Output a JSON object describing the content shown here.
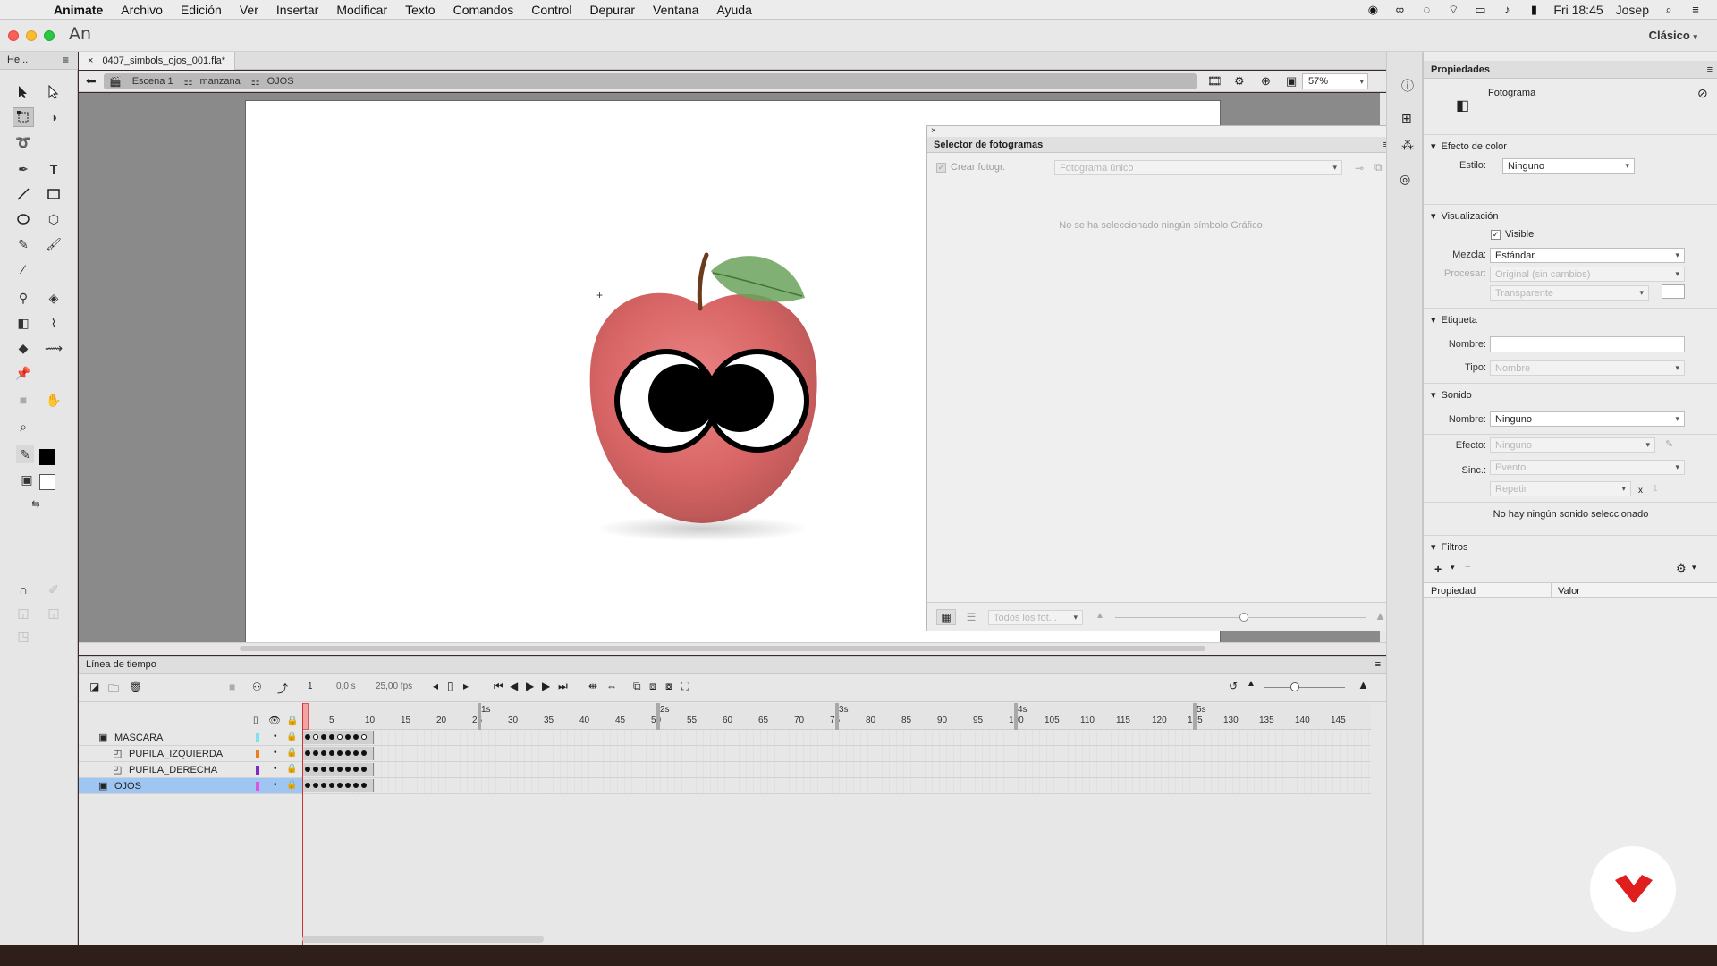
{
  "menubar": {
    "app": "Animate",
    "items": [
      "Archivo",
      "Edición",
      "Ver",
      "Insertar",
      "Modificar",
      "Texto",
      "Comandos",
      "Control",
      "Depurar",
      "Ventana",
      "Ayuda"
    ],
    "clock": "Fri 18:45",
    "user": "Josep"
  },
  "window": {
    "app_short": "An",
    "workspace": "Clásico"
  },
  "tools_panel": {
    "title": "He..."
  },
  "document": {
    "tab": "0407_simbols_ojos_001.fla*",
    "breadcrumbs": [
      "Escena 1",
      "manzana",
      "OJOS"
    ],
    "zoom": "57%"
  },
  "frame_picker": {
    "title": "Selector de fotogramas",
    "create_frame_label": "Crear fotogr.",
    "mode_value": "Fotograma único",
    "message": "No se ha seleccionado ningún símbolo Gráfico",
    "filter_value": "Todos los fot..."
  },
  "timeline": {
    "title": "Línea de tiempo",
    "current_frame": "1",
    "time": "0,0 s",
    "fps": "25,00 fps",
    "ruler_ticks": [
      "5",
      "10",
      "15",
      "20",
      "25",
      "30",
      "35",
      "40",
      "45",
      "50",
      "55",
      "60",
      "65",
      "70",
      "75",
      "80",
      "85",
      "90",
      "95",
      "100",
      "105",
      "110",
      "115",
      "120",
      "125",
      "130",
      "135",
      "140",
      "145"
    ],
    "second_markers": [
      "1s",
      "2s",
      "3s",
      "4s",
      "5s"
    ],
    "layers": [
      {
        "name": "MASCARA",
        "color": "#7fe3e6",
        "selected": false,
        "indent": 0
      },
      {
        "name": "PUPILA_IZQUIERDA",
        "color": "#f07b1e",
        "selected": false,
        "indent": 1
      },
      {
        "name": "PUPILA_DERECHA",
        "color": "#7a2dbf",
        "selected": false,
        "indent": 1
      },
      {
        "name": "OJOS",
        "color": "#e052e0",
        "selected": true,
        "indent": 0
      }
    ]
  },
  "properties": {
    "title": "Propiedades",
    "object_type": "Fotograma",
    "color_effect": {
      "header": "Efecto de color",
      "style_label": "Estilo:",
      "style_value": "Ninguno"
    },
    "display": {
      "header": "Visualización",
      "visible_label": "Visible",
      "visible_checked": true,
      "blend_label": "Mezcla:",
      "blend_value": "Estándar",
      "render_label": "Procesar:",
      "render_value": "Original (sin cambios)",
      "transparent_value": "Transparente"
    },
    "label": {
      "header": "Etiqueta",
      "name_label": "Nombre:",
      "name_value": "",
      "type_label": "Tipo:",
      "type_value": "Nombre"
    },
    "sound": {
      "header": "Sonido",
      "name_label": "Nombre:",
      "name_value": "Ninguno",
      "effect_label": "Efecto:",
      "effect_value": "Ninguno",
      "sync_label": "Sinc.:",
      "sync_value": "Evento",
      "repeat_value": "Repetir",
      "repeat_x": "x",
      "repeat_count": "1",
      "none_msg": "No hay ningún sonido seleccionado"
    },
    "filters": {
      "header": "Filtros",
      "col_property": "Propiedad",
      "col_value": "Valor"
    }
  }
}
